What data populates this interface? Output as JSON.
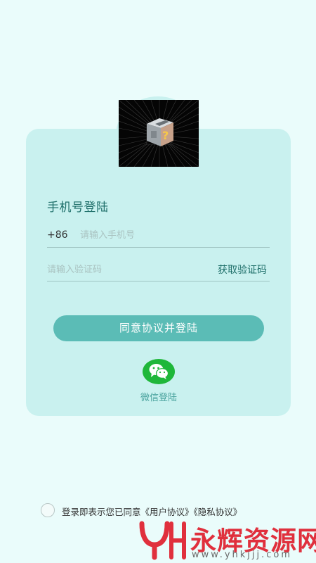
{
  "login": {
    "title": "手机号登陆",
    "country_code": "+86",
    "phone_placeholder": "请输入手机号",
    "code_placeholder": "请输入验证码",
    "get_code_label": "获取验证码",
    "submit_label": "同意协议并登陆",
    "wechat_label": "微信登陆"
  },
  "agreement": {
    "prefix": "登录即表示您已同意",
    "user_agreement": "《用户协议》",
    "privacy_agreement": "《隐私协议》"
  },
  "watermark": {
    "logo_text": "YH",
    "title": "永辉资源网",
    "url": "www.yhkjjj.com"
  },
  "colors": {
    "page_bg": "#eafcfb",
    "card_bg": "#c9f1ef",
    "accent": "#5bbcb6",
    "title_text": "#1f6f6a",
    "wechat_green": "#1fb73a",
    "watermark_red": "#e0303d"
  },
  "icons": {
    "logo": "mystery-box-icon",
    "wechat": "wechat-icon",
    "checkbox": "circle-checkbox-icon"
  }
}
